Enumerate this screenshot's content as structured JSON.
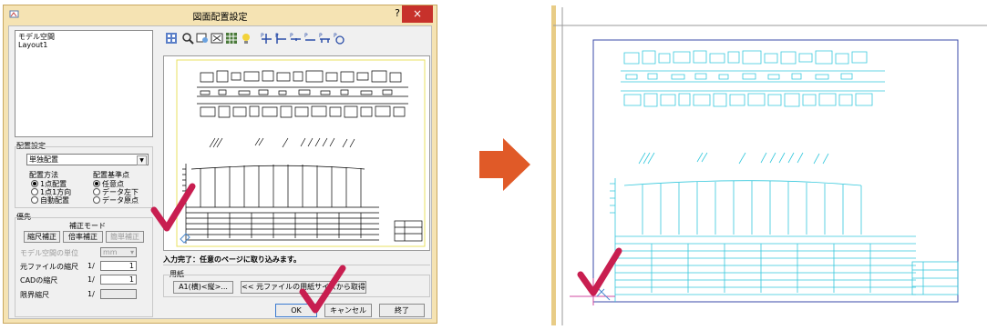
{
  "dialog": {
    "title": "図面配置設定",
    "help": "?",
    "close": "×",
    "layout_list": [
      "モデル空間",
      "Layout1"
    ],
    "placement": {
      "group_title": "配置設定",
      "combo_value": "単独配置",
      "method_label": "配置方法",
      "method_options": [
        "1点配置",
        "1点1方向",
        "自動配置"
      ],
      "base_label": "配置基準点",
      "base_options": [
        "任意点",
        "データ左下",
        "データ原点"
      ]
    },
    "priority": {
      "group_title": "優先",
      "mode_label": "補正モード",
      "buttons": [
        "縮尺補正",
        "倍率補正",
        "簡単補正"
      ],
      "unit_label": "モデル空間の単位",
      "unit_value": "mm",
      "rows": [
        {
          "label": "元ファイルの縮尺",
          "prefix": "1/",
          "value": "1"
        },
        {
          "label": "CADの縮尺",
          "prefix": "1/",
          "value": "1"
        },
        {
          "label": "限界縮尺",
          "prefix": "1/",
          "value": ""
        }
      ]
    },
    "status_text": "入力完了：任意のページに取り込みます。",
    "paper": {
      "group_title": "用紙",
      "size_button": "A1(横)<縦>...",
      "fetch_button": "<< 元ファイルの用紙サイズから取得"
    },
    "ok": "OK",
    "cancel": "キャンセル",
    "exit": "終了"
  },
  "toolbar_icons": [
    "layer-icon",
    "zoom-icon",
    "zoom-window-icon",
    "fit-icon",
    "grid-icon",
    "bulb-icon",
    "p-cross-icon",
    "p-left-icon",
    "p-right-icon",
    "p-bottom-icon",
    "p-center-icon",
    "p-rotate-icon"
  ],
  "colors": {
    "dialog_frame": "#f5e3b3",
    "close": "#c7312b",
    "check": "#c81e50",
    "arrow": "#e05a28",
    "cad_line": "#35c8dc"
  }
}
